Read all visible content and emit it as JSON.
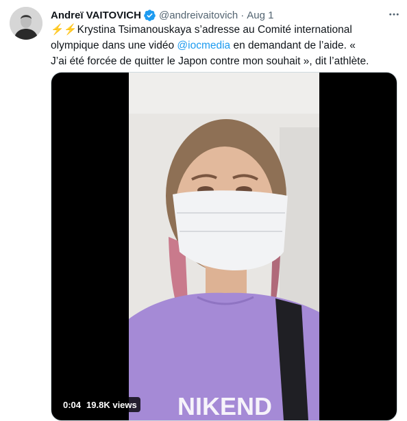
{
  "tweet": {
    "author_name": "Andreï VAITOVICH",
    "handle": "@andreivaitovich",
    "separator": "·",
    "date": "Aug 1",
    "text_emoji": "⚡⚡",
    "text_part1": "Krystina Tsimanouskaya s’adresse au Comité international olympique dans une vidéo ",
    "mention": "@iocmedia",
    "text_part2": " en demandant de l’aide. « J’ai été forcée de quitter le Japon contre mon souhait », dit l’athlète."
  },
  "video": {
    "duration": "0:04",
    "views": "19.8K views",
    "shirt_text": "NIKEND"
  },
  "colors": {
    "accent": "#1d9bf0",
    "verified": "#1d9bf0",
    "shirt": "#a58ad6",
    "mask": "#f2f3f5"
  },
  "icons": [
    "verified-badge-icon",
    "more-options-icon"
  ]
}
